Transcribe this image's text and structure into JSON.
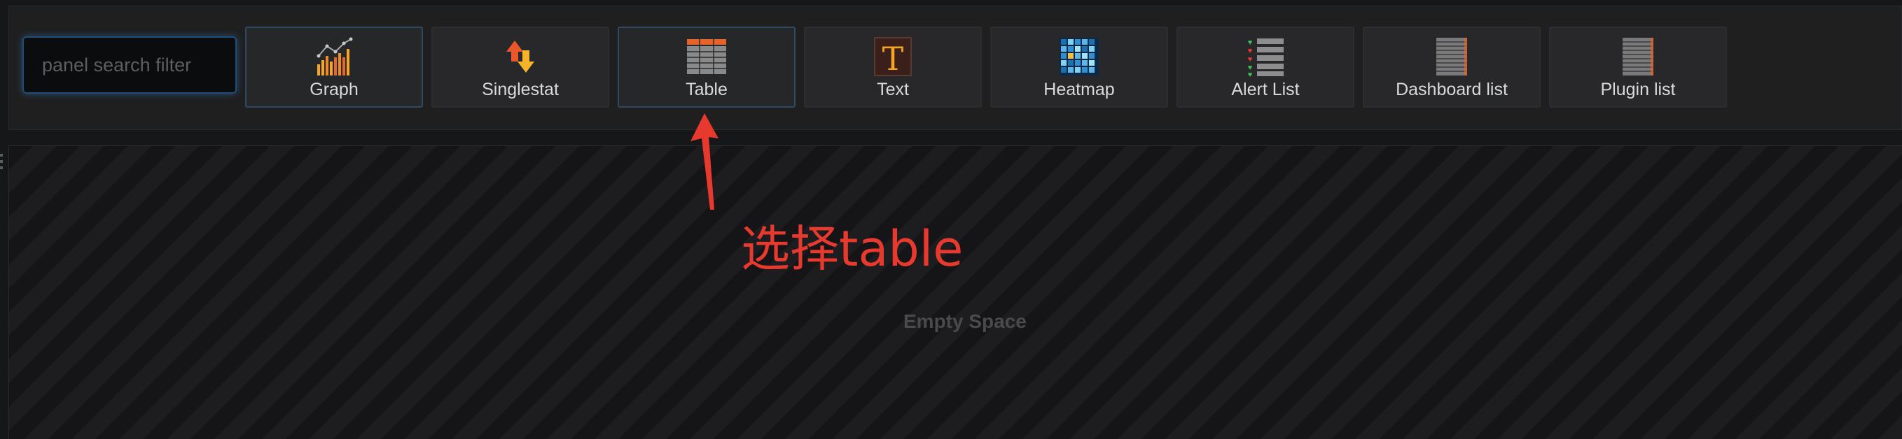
{
  "search": {
    "placeholder": "panel search filter",
    "value": ""
  },
  "panels": [
    {
      "label": "Graph",
      "icon": "graph-icon",
      "active": true
    },
    {
      "label": "Singlestat",
      "icon": "singlestat-icon",
      "active": false
    },
    {
      "label": "Table",
      "icon": "table-icon",
      "active": true
    },
    {
      "label": "Text",
      "icon": "text-icon",
      "active": false
    },
    {
      "label": "Heatmap",
      "icon": "heatmap-icon",
      "active": false
    },
    {
      "label": "Alert List",
      "icon": "alert-list-icon",
      "active": false
    },
    {
      "label": "Dashboard list",
      "icon": "dashboard-list-icon",
      "active": false
    },
    {
      "label": "Plugin list",
      "icon": "plugin-list-icon",
      "active": false
    }
  ],
  "empty_space": {
    "label": "Empty Space"
  },
  "annotation": {
    "text": "选择table"
  },
  "colors": {
    "annotation": "#e8392e",
    "active_border": "#2f4a60",
    "search_glow": "#3378be"
  }
}
